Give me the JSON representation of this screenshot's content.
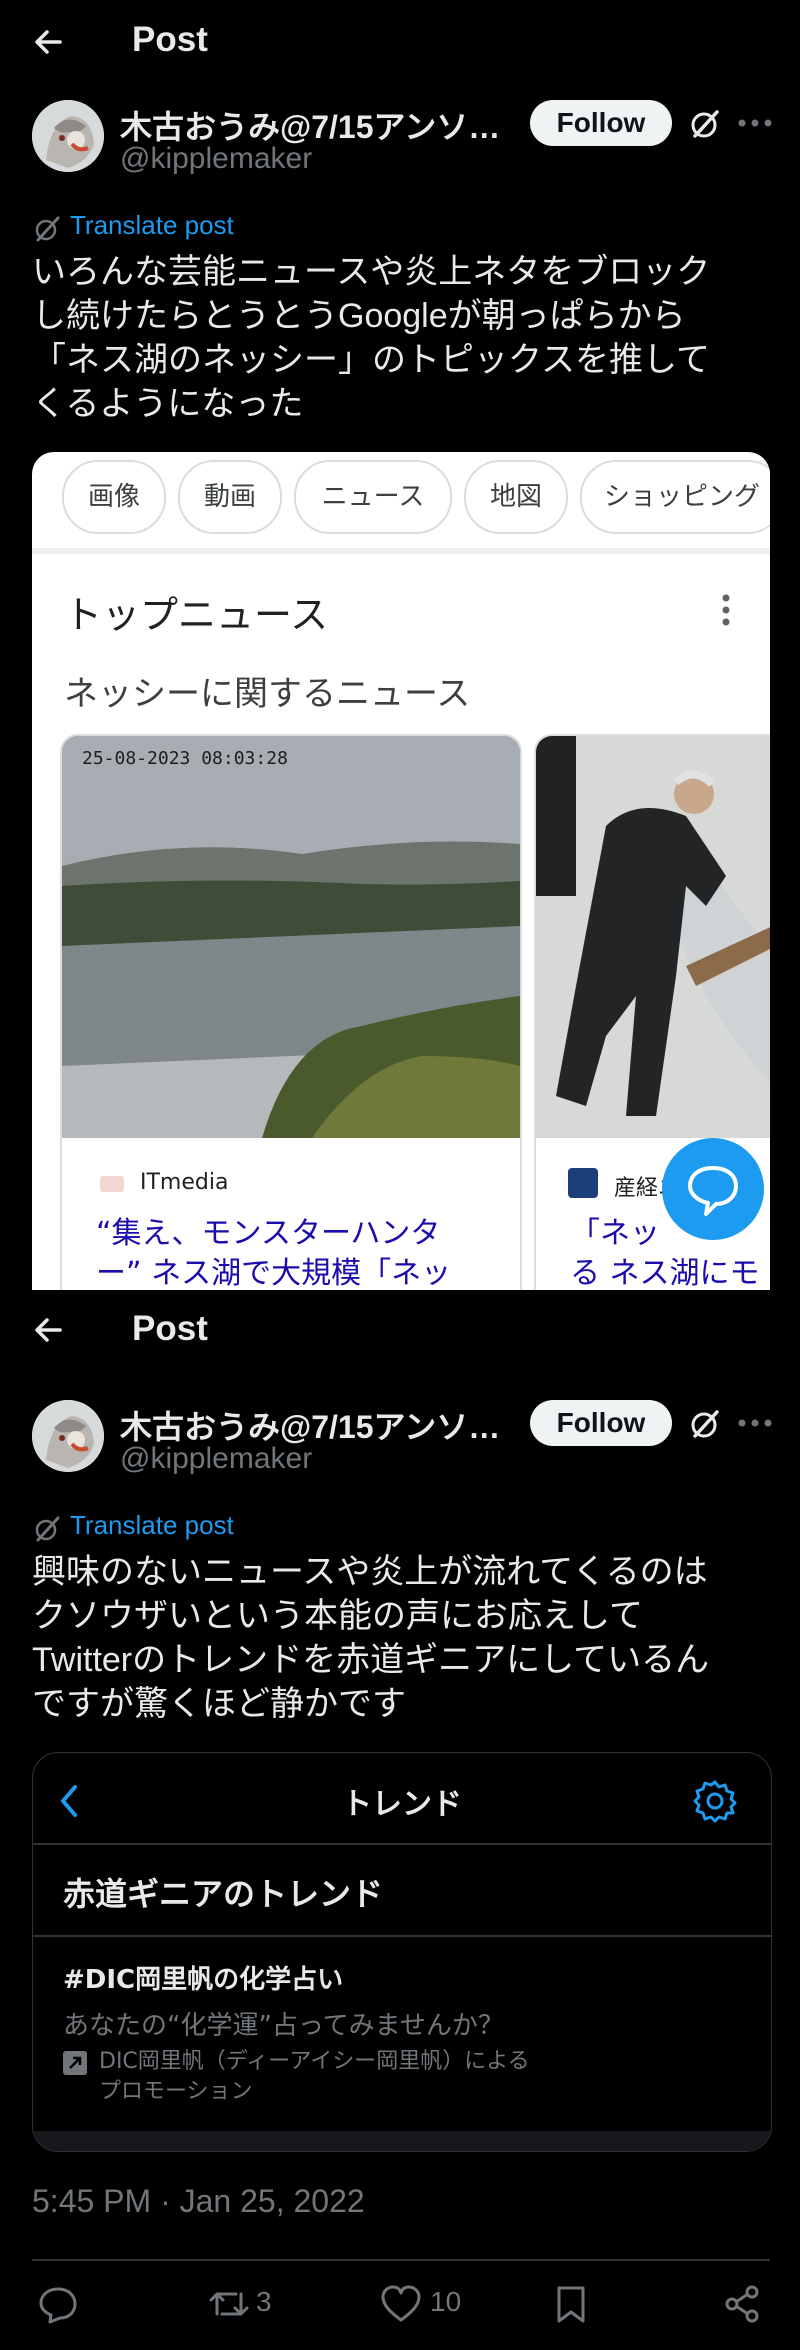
{
  "header": {
    "title": "Post"
  },
  "user": {
    "display_name": "木古おうみ@7/15アンソ…",
    "handle": "@kipplemaker",
    "follow_label": "Follow"
  },
  "post1": {
    "translate_label": "Translate post",
    "text": "いろんな芸能ニュースや炎上ネタをブロック\nし続けたらとうとうGoogleが朝っぱらから\n「ネス湖のネッシー」のトピックスを推して\nくるようになった"
  },
  "google": {
    "chips": [
      "画像",
      "動画",
      "ニュース",
      "地図",
      "ショッピング"
    ],
    "top_news": "トップニュース",
    "section_title": "ネッシーに関するニュース",
    "cards": [
      {
        "timestamp_overlay": "25-08-2023 08:03:28",
        "source": "ITmedia",
        "headline": "“集え、モンスターハンタ\nー” ネス湖で大規模「ネッ"
      },
      {
        "source": "産経ニ",
        "headline": "「ネッ\nる ネス湖にモ"
      }
    ]
  },
  "post2": {
    "translate_label": "Translate post",
    "text": "興味のないニュースや炎上が流れてくるのは\nクソウザいという本能の声にお応えして\nTwitterのトレンドを赤道ギニアにしているん\nですが驚くほど静かです"
  },
  "trends": {
    "title": "トレンド",
    "heading": "赤道ギニアのトレンド",
    "tag": "#DIC岡里帆の化学占い",
    "description": "あなたの“化学運”占ってみませんか？",
    "promo": "DIC岡里帆（ディーアイシー岡里帆）による\nプロモーション"
  },
  "timestamp": "5:45 PM · Jan 25, 2022",
  "actions": {
    "retweets": "3",
    "likes": "10"
  },
  "colors": {
    "accent": "#1d9bf0",
    "background": "#000000",
    "text": "#e7e9ea",
    "muted": "#71767b",
    "google_link": "#1a0dab"
  },
  "icons": [
    "back-arrow-icon",
    "grok-icon",
    "more-icon",
    "translate-icon",
    "kebab-icon",
    "chat-fab-icon",
    "chevron-left-icon",
    "gear-icon",
    "promoted-icon",
    "reply-icon",
    "retweet-icon",
    "like-icon",
    "bookmark-icon",
    "share-icon"
  ]
}
